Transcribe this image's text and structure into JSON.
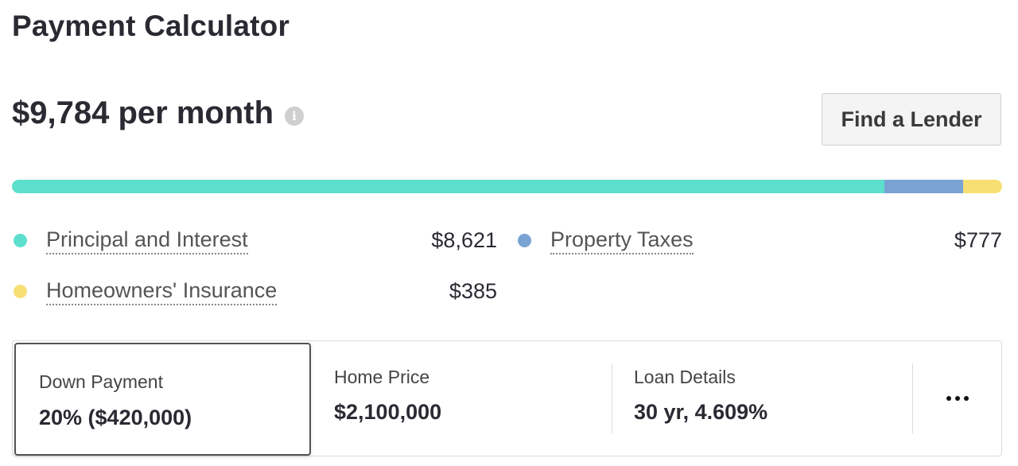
{
  "header": {
    "title": "Payment Calculator"
  },
  "summary": {
    "monthly_payment": "$9,784 per month",
    "info_icon": "info-icon",
    "find_lender_label": "Find a Lender"
  },
  "breakdown": {
    "colors": {
      "principal": "#5ddfcd",
      "taxes": "#7aa3d4",
      "insurance": "#f8df74"
    },
    "items": [
      {
        "label": "Principal and Interest",
        "value": "$8,621",
        "amount": 8621,
        "color": "#5ddfcd"
      },
      {
        "label": "Property Taxes",
        "value": "$777",
        "amount": 777,
        "color": "#7aa3d4"
      },
      {
        "label": "Homeowners' Insurance",
        "value": "$385",
        "amount": 385,
        "color": "#f8df74"
      }
    ]
  },
  "inputs": {
    "down_payment": {
      "label": "Down Payment",
      "value": "20% ($420,000)"
    },
    "home_price": {
      "label": "Home Price",
      "value": "$2,100,000"
    },
    "loan_details": {
      "label": "Loan Details",
      "value": "30 yr, 4.609%"
    },
    "more_icon": "more-horizontal-icon"
  }
}
